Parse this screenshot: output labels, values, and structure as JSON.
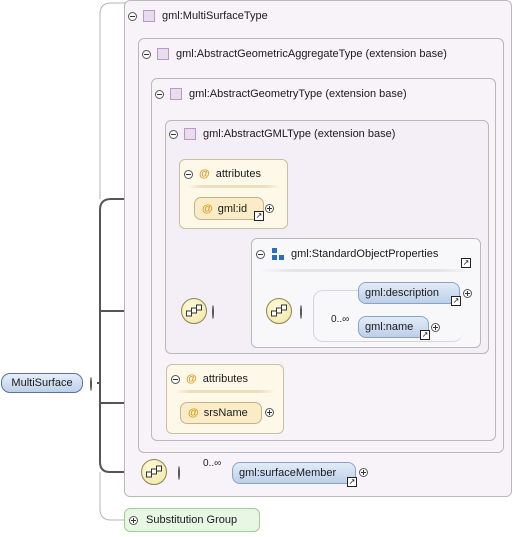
{
  "root": {
    "label": "MultiSurface"
  },
  "types": [
    {
      "label": "gml:MultiSurfaceType"
    },
    {
      "label": "gml:AbstractGeometricAggregateType (extension base)"
    },
    {
      "label": "gml:AbstractGeometryType (extension base)"
    },
    {
      "label": "gml:AbstractGMLType (extension base)"
    }
  ],
  "attribute_groups": [
    {
      "label": "attributes",
      "attr": "gml:id"
    },
    {
      "label": "attributes",
      "attr": "srsName"
    }
  ],
  "group_ref": {
    "label": "gml:StandardObjectProperties"
  },
  "elements": {
    "description": "gml:description",
    "name": "gml:name",
    "surface_member": "gml:surfaceMember"
  },
  "multiplicity": {
    "choice": "0..∞",
    "surface_member": "0..∞"
  },
  "substitution": {
    "label": "Substitution Group"
  },
  "icons": {
    "collapse": "minus-circle-icon",
    "expand": "plus-circle-icon",
    "type": "type-square-icon",
    "attribute": "at-sign-icon",
    "group": "group-blocks-icon",
    "sequence": "sequence-compositor-icon",
    "reference": "reference-arrow-icon"
  }
}
